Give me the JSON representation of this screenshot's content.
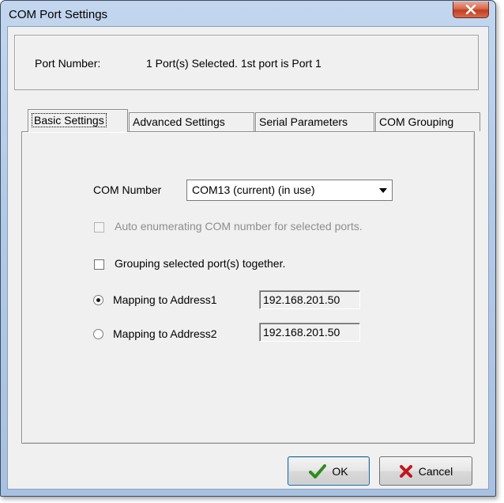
{
  "window": {
    "title": "COM Port Settings",
    "close_icon": "close-x-icon"
  },
  "port_info": {
    "label": "Port Number:",
    "value": "1 Port(s) Selected. 1st port is Port 1"
  },
  "tabs": [
    {
      "label": "Basic Settings",
      "active": true
    },
    {
      "label": "Advanced Settings",
      "active": false
    },
    {
      "label": "Serial Parameters",
      "active": false
    },
    {
      "label": "COM Grouping",
      "active": false
    }
  ],
  "basic": {
    "com_number_label": "COM Number",
    "com_number_value": "COM13 (current) (in use)",
    "auto_enum_label": "Auto enumerating COM number for selected ports.",
    "auto_enum_checked": false,
    "auto_enum_enabled": false,
    "grouping_label": "Grouping selected port(s) together.",
    "grouping_checked": false,
    "mapping1_label": "Mapping to Address1",
    "mapping1_value": "192.168.201.50",
    "mapping1_selected": true,
    "mapping2_label": "Mapping to Address2",
    "mapping2_value": "192.168.201.50",
    "mapping2_selected": false
  },
  "buttons": {
    "ok_label": "OK",
    "ok_icon": "checkmark-icon",
    "cancel_label": "Cancel",
    "cancel_icon": "x-icon"
  },
  "colors": {
    "ok_check": "#2e8b1e",
    "cancel_x": "#c0181e",
    "titlebar": "#b3cae7"
  }
}
